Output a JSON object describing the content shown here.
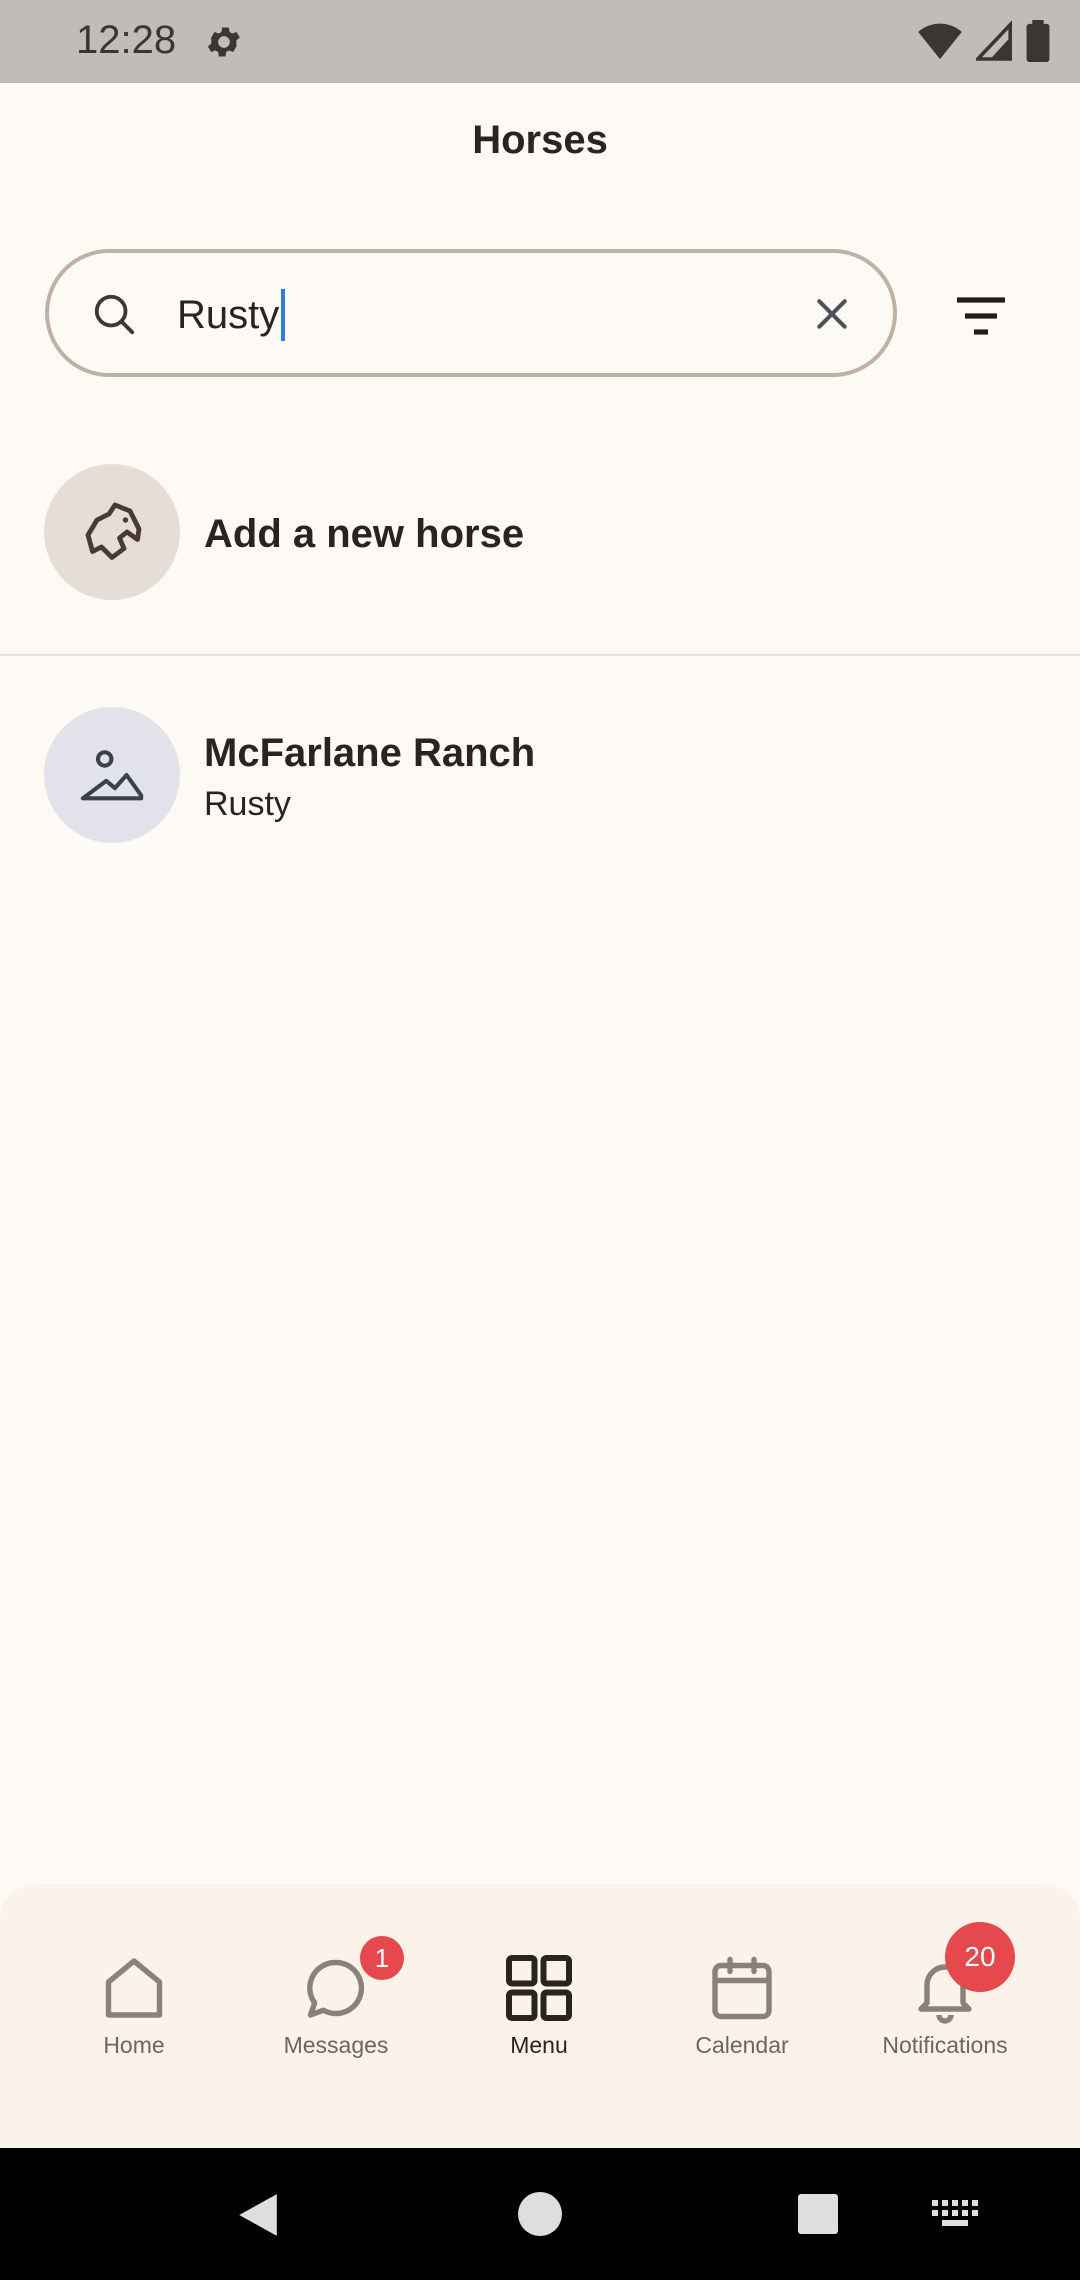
{
  "status_bar": {
    "time": "12:28",
    "icons": [
      "gear-icon",
      "wifi-icon",
      "signal-icon",
      "battery-icon"
    ]
  },
  "header": {
    "title": "Horses"
  },
  "search": {
    "value": "Rusty",
    "icons": [
      "search-icon",
      "clear-icon",
      "filter-icon"
    ]
  },
  "add_horse": {
    "label": "Add a new horse",
    "icon": "horse-head-icon"
  },
  "results": [
    {
      "title": "McFarlane Ranch",
      "subtitle": "Rusty",
      "icon": "image-placeholder-icon"
    }
  ],
  "bottom_nav": {
    "items": [
      {
        "label": "Home",
        "icon": "home-icon"
      },
      {
        "label": "Messages",
        "icon": "chat-icon",
        "badge": "1"
      },
      {
        "label": "Menu",
        "icon": "grid-icon",
        "active": true
      },
      {
        "label": "Calendar",
        "icon": "calendar-icon"
      },
      {
        "label": "Notifications",
        "icon": "bell-icon",
        "badge": "20"
      }
    ]
  },
  "colors": {
    "background": "#fdfaf5",
    "badge": "#e5484d",
    "caret": "#2f7fd8",
    "status_bar": "#c1bcb8"
  },
  "system_nav": {
    "icons": [
      "back-icon",
      "home-circle-icon",
      "recents-icon",
      "keyboard-icon"
    ]
  }
}
